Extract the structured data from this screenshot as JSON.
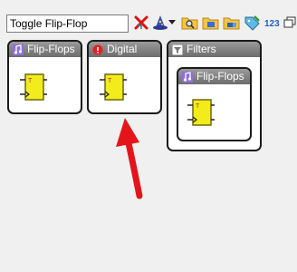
{
  "toolbar": {
    "search_value": "Toggle Flip-Flop",
    "buttons": [
      {
        "name": "clear-filter-icon"
      },
      {
        "name": "wizard-hat-icon"
      },
      {
        "name": "dropdown-arrow-icon"
      },
      {
        "name": "folder-search-icon"
      },
      {
        "name": "folder-open-icon"
      },
      {
        "name": "folder-add-icon"
      },
      {
        "name": "tag-edit-icon"
      },
      {
        "name": "numeric-sort-icon"
      },
      {
        "name": "window-restore-icon"
      }
    ],
    "numeric_sort_label": "123"
  },
  "panels": {
    "flipflops": {
      "title": "Flip-Flops",
      "icon": "music-note-icon"
    },
    "digital": {
      "title": "Digital",
      "icon": "red-circle-icon"
    },
    "filters": {
      "title": "Filters",
      "icon": "funnel-icon",
      "inner": {
        "title": "Flip-Flops",
        "icon": "music-note-icon"
      }
    }
  },
  "colors": {
    "header_top": "#9a9a9a",
    "header_bottom": "#6d6d6d",
    "component_yellow": "#f2ec1c",
    "arrow_red": "#e3151a"
  }
}
